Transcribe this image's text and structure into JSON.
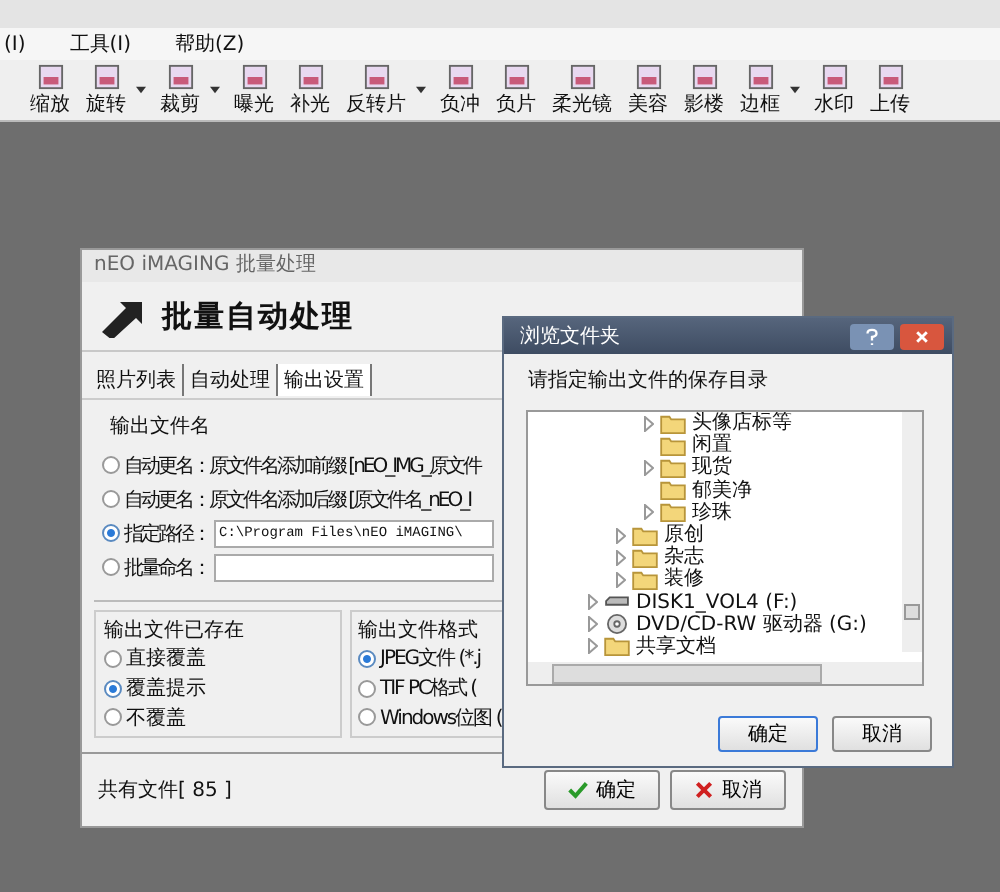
{
  "menu": [
    "(I)",
    "工具(I)",
    "帮助(Z)"
  ],
  "toolbar": [
    {
      "label": "缩放",
      "dropdown": false
    },
    {
      "label": "旋转",
      "dropdown": true
    },
    {
      "label": "裁剪",
      "dropdown": true
    },
    {
      "label": "曝光",
      "dropdown": false
    },
    {
      "label": "补光",
      "dropdown": false
    },
    {
      "label": "反转片",
      "dropdown": true
    },
    {
      "label": "负冲",
      "dropdown": false
    },
    {
      "label": "负片",
      "dropdown": false
    },
    {
      "label": "柔光镜",
      "dropdown": false
    },
    {
      "label": "美容",
      "dropdown": false
    },
    {
      "label": "影楼",
      "dropdown": false
    },
    {
      "label": "边框",
      "dropdown": true
    },
    {
      "label": "水印",
      "dropdown": false
    },
    {
      "label": "上传",
      "dropdown": false
    }
  ],
  "batch_dialog": {
    "title": "nEO iMAGING 批量处理",
    "heading": "批量自动处理",
    "tabs": [
      {
        "label": "照片列表",
        "selected": false
      },
      {
        "label": "自动处理",
        "selected": false
      },
      {
        "label": "输出设置",
        "selected": true
      }
    ],
    "output_name": {
      "label": "输出文件名",
      "options": [
        {
          "kind": "text",
          "label": "自动更名：原文件名添加前缀 [nEO_IMG_原文件",
          "selected": false
        },
        {
          "kind": "text",
          "label": "自动更名：原文件名添加后缀 [原文件名_nEO_I",
          "selected": false
        },
        {
          "kind": "field",
          "label": "指定路径：",
          "value": "C:\\Program Files\\nEO iMAGING\\",
          "selected": true
        },
        {
          "kind": "field",
          "label": "批量命名：",
          "selected": false
        }
      ]
    },
    "if_exists": {
      "label": "输出文件已存在",
      "options": [
        {
          "label": "直接覆盖",
          "selected": false
        },
        {
          "label": "覆盖提示",
          "selected": true
        },
        {
          "label": "不覆盖",
          "selected": false
        }
      ]
    },
    "format": {
      "label": "输出文件格式",
      "options": [
        {
          "label": "JPEG文件 (*.j",
          "selected": true
        },
        {
          "label": "TIF PC格式 (",
          "selected": false
        },
        {
          "label": "Windows位图 (",
          "selected": false
        }
      ]
    },
    "file_count": "共有文件[ 85 ]",
    "buttons": [
      {
        "kind": "ok",
        "label": "确定"
      },
      {
        "kind": "cancel",
        "label": "取消"
      }
    ]
  },
  "browse_dialog": {
    "title": "浏览文件夹",
    "prompt": "请指定输出文件的保存目录",
    "tree": [
      {
        "children": [
          {
            "children": [
              {
                "kind": "folder",
                "label": "头像店标等",
                "has_children": true
              },
              {
                "kind": "folder",
                "label": "闲置",
                "has_children": false
              },
              {
                "kind": "folder",
                "label": "现货",
                "has_children": true
              },
              {
                "kind": "folder",
                "label": "郁美净",
                "has_children": false
              },
              {
                "kind": "folder",
                "label": "珍珠",
                "has_children": true
              }
            ]
          },
          {
            "kind": "folder",
            "label": "原创",
            "has_children": true
          },
          {
            "kind": "folder",
            "label": "杂志",
            "has_children": true
          },
          {
            "kind": "folder",
            "label": "装修",
            "has_children": true
          }
        ]
      },
      {
        "kind": "drive",
        "label": "DISK1_VOL4 (F:)",
        "has_children": true
      },
      {
        "kind": "dvd",
        "label": "DVD/CD-RW 驱动器 (G:)",
        "has_children": true
      },
      {
        "kind": "folder",
        "label": "共享文档",
        "has_children": true
      }
    ],
    "buttons": [
      "确定",
      "取消"
    ]
  }
}
